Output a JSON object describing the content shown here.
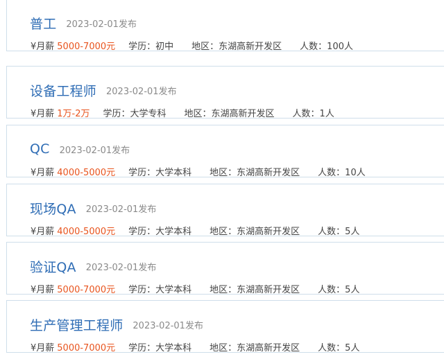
{
  "jobs": [
    {
      "title": "普工",
      "date": "2023-02-01发布",
      "salary_label": "¥月薪",
      "salary": "5000-7000元",
      "education": "学历：初中",
      "area": "地区：东湖高新开发区",
      "count": "人数：100人"
    },
    {
      "title": "设备工程师",
      "date": "2023-02-01发布",
      "salary_label": "¥月薪",
      "salary": "1万-2万",
      "education": "学历：大学专科",
      "area": "地区：东湖高新开发区",
      "count": "人数：1人"
    },
    {
      "title": "QC",
      "date": "2023-02-01发布",
      "salary_label": "¥月薪",
      "salary": "4000-5000元",
      "education": "学历：大学本科",
      "area": "地区：东湖高新开发区",
      "count": "人数：10人"
    },
    {
      "title": "现场QA",
      "date": "2023-02-01发布",
      "salary_label": "¥月薪",
      "salary": "4000-5000元",
      "education": "学历：大学本科",
      "area": "地区：东湖高新开发区",
      "count": "人数：5人"
    },
    {
      "title": "验证QA",
      "date": "2023-02-01发布",
      "salary_label": "¥月薪",
      "salary": "5000-7000元",
      "education": "学历：大学本科",
      "area": "地区：东湖高新开发区",
      "count": "人数：5人"
    },
    {
      "title": "生产管理工程师",
      "date": "2023-02-01发布",
      "salary_label": "¥月薪",
      "salary": "5000-7000元",
      "education": "学历：大学本科",
      "area": "地区：东湖高新开发区",
      "count": "人数：5人"
    }
  ],
  "colors": {
    "title": "#2f6db5",
    "salary": "#e8541e",
    "border": "#cfdeea",
    "meta": "#444444",
    "date": "#8a8a8a"
  }
}
